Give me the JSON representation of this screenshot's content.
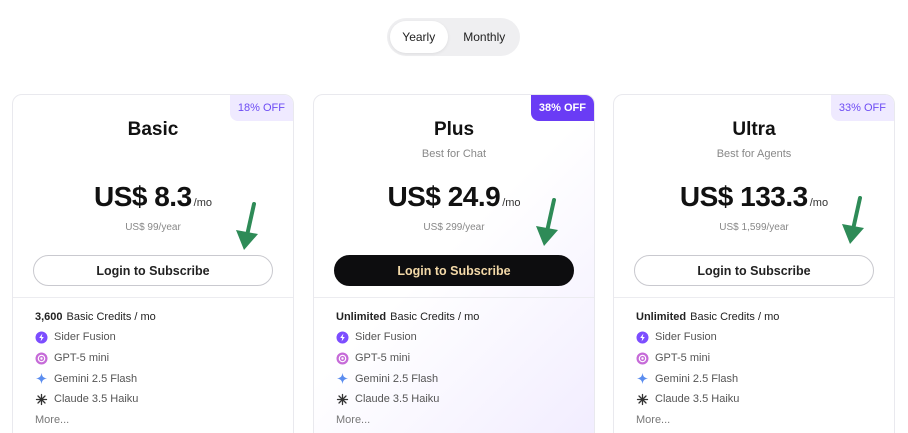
{
  "toggle": {
    "yearly_label": "Yearly",
    "monthly_label": "Monthly",
    "selected": "Yearly"
  },
  "plans": [
    {
      "name": "Basic",
      "subtitle": "",
      "badge": "18% OFF",
      "price": "US$ 8.3",
      "per": "/mo",
      "yearly": "US$ 99/year",
      "button": "Login to Subscribe",
      "credits_bold": "3,600",
      "credits_text": "Basic Credits / mo",
      "features": [
        "Sider Fusion",
        "GPT-5 mini",
        "Gemini 2.5 Flash",
        "Claude 3.5 Haiku"
      ],
      "more": "More..."
    },
    {
      "name": "Plus",
      "subtitle": "Best for Chat",
      "badge": "38% OFF",
      "price": "US$ 24.9",
      "per": "/mo",
      "yearly": "US$ 299/year",
      "button": "Login to Subscribe",
      "credits_bold": "Unlimited",
      "credits_text": "Basic Credits / mo",
      "features": [
        "Sider Fusion",
        "GPT-5 mini",
        "Gemini 2.5 Flash",
        "Claude 3.5 Haiku"
      ],
      "more": "More..."
    },
    {
      "name": "Ultra",
      "subtitle": "Best for Agents",
      "badge": "33% OFF",
      "price": "US$ 133.3",
      "per": "/mo",
      "yearly": "US$ 1,599/year",
      "button": "Login to Subscribe",
      "credits_bold": "Unlimited",
      "credits_text": "Basic Credits / mo",
      "features": [
        "Sider Fusion",
        "GPT-5 mini",
        "Gemini 2.5 Flash",
        "Claude 3.5 Haiku"
      ],
      "more": "More..."
    }
  ],
  "feature_icons": [
    "sider-fusion-icon",
    "gpt-icon",
    "gemini-icon",
    "claude-icon"
  ],
  "colors": {
    "accent_purple": "#6a3cf5",
    "badge_light_bg": "#efeaff",
    "dark_button": "#0d0d0f",
    "arrow_green": "#2e8b57"
  }
}
